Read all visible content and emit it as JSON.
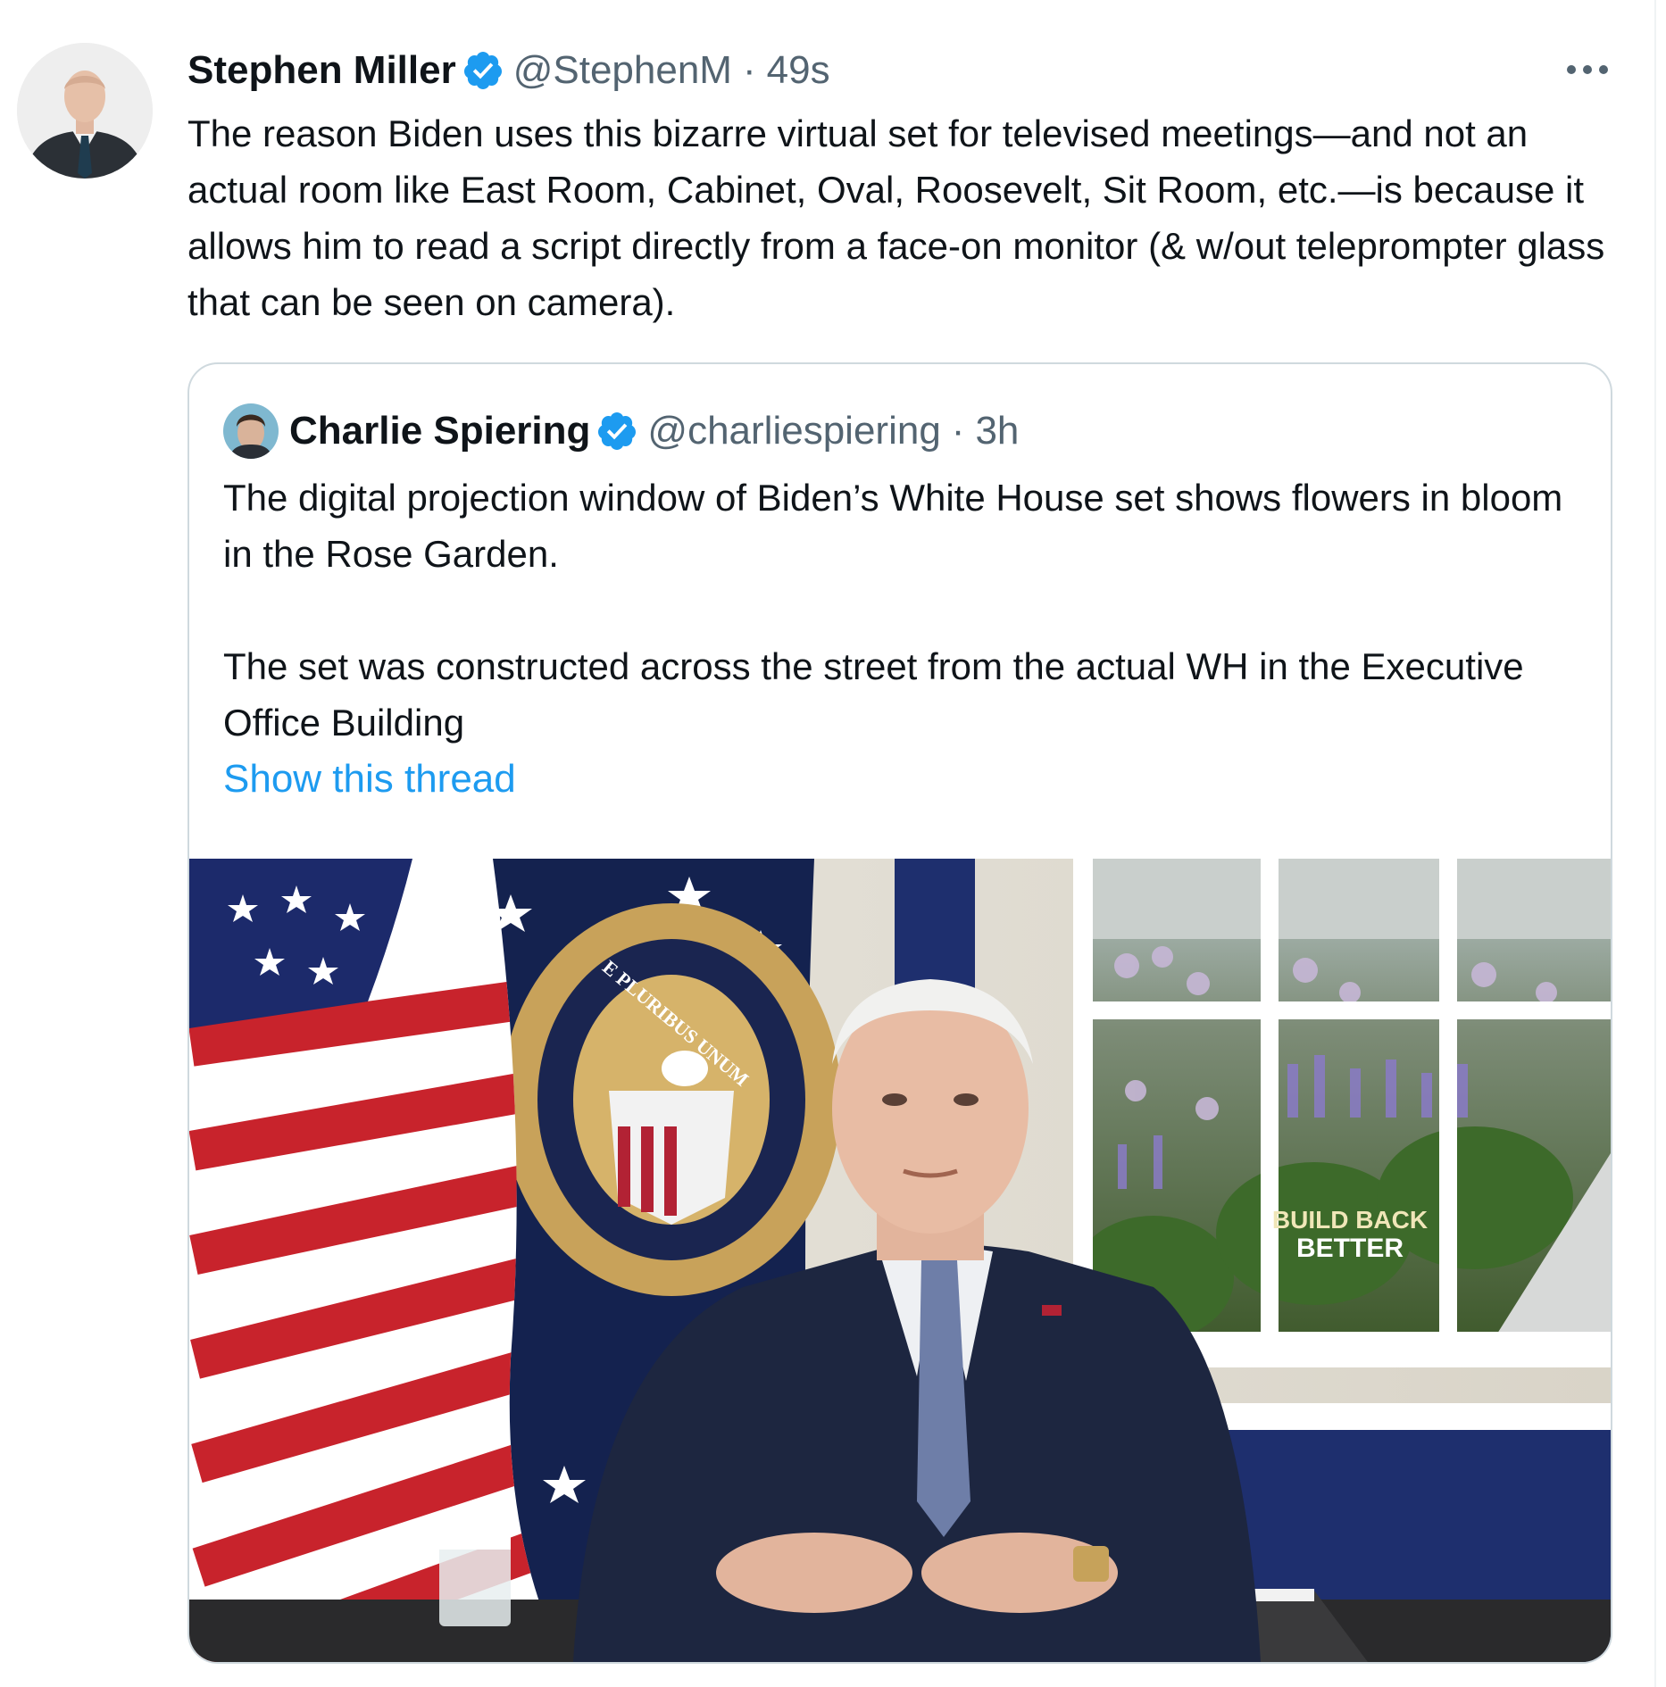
{
  "tweet": {
    "author_name": "Stephen Miller",
    "handle": "@StephenM",
    "separator": "·",
    "time": "49s",
    "text": "The reason Biden uses this bizarre virtual set for televised meetings—and not an actual room like East Room, Cabinet, Oval, Roosevelt, Sit Room, etc.—is because it allows him to read a script directly from a face-on monitor (& w/out teleprompter glass that can be seen on camera).",
    "verified": true,
    "avatar_icon": "profile-photo",
    "more_icon": "ellipsis-icon"
  },
  "quoted_tweet": {
    "author_name": "Charlie Spiering",
    "handle": "@charliespiering",
    "separator": "·",
    "time": "3h",
    "text": "The digital projection window of Biden’s White House set shows flowers in bloom in the Rose Garden.\n\nThe set was constructed across the street from the actual WH in the Executive Office Building",
    "show_thread": "Show this thread",
    "verified": true,
    "media": {
      "seal_motto": "E PLURIBUS UNUM",
      "window_caption_line1": "BUILD BACK",
      "window_caption_line2": "BETTER"
    }
  },
  "colors": {
    "text_primary": "#0f1419",
    "text_secondary": "#536471",
    "link": "#1d9bf0",
    "verified": "#1d9bf0",
    "border": "#cfd9de"
  }
}
